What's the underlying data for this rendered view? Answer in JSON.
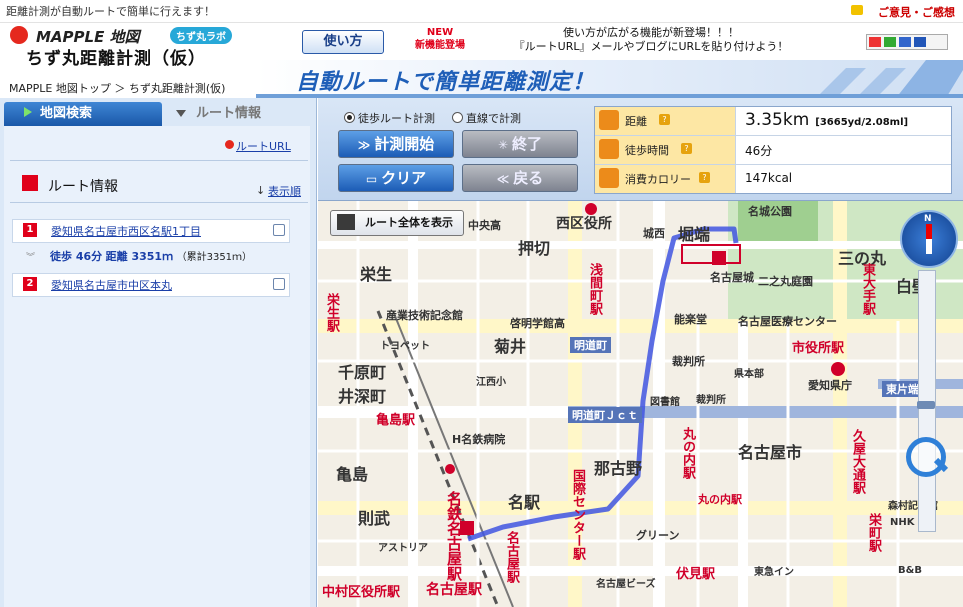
{
  "topbar": {
    "message": "距離計測が自動ルートで簡単に行えます！",
    "feedback_label": "ご意見・ご感想"
  },
  "header": {
    "brand": "MAPPLE 地図",
    "lab_badge": "ちず丸ラボ",
    "app_title": "ちず丸距離計測（仮）",
    "howto_label": "使い方",
    "new_badge_line1": "NEW",
    "new_badge_line2": "新機能登場",
    "news_line1": "使い方が広がる機能が新登場！！！",
    "news_line2": "『ルートURL』メールやブログにURLを貼り付けよう！",
    "breadcrumb_home": "MAPPLE 地図トップ",
    "breadcrumb_sep": "＞",
    "breadcrumb_current": "ちず丸距離計測(仮)",
    "banner_text": "自動ルートで簡単距離測定！"
  },
  "sidebar": {
    "tab_search": "地図検索",
    "tab_route": "ルート情報",
    "route_url_label": "ルートURL",
    "route_heading": "ルート情報",
    "order_label": "表示順",
    "waypoints": [
      {
        "num": "1",
        "address": "愛知県名古屋市西区名駅1丁目"
      },
      {
        "num": "2",
        "address": "愛知県名古屋市中区本丸"
      }
    ],
    "segment": {
      "walk_label": "徒歩 46分",
      "distance_label": "距離 3351ｍ",
      "cumulative": "（累計3351ｍ）"
    }
  },
  "controls": {
    "mode_walk": "徒歩ルート計測",
    "mode_straight": "直線で計測",
    "mode_selected": "walk",
    "start_label": "計測開始",
    "end_label": "終了",
    "clear_label": "クリア",
    "back_label": "戻る"
  },
  "stats": {
    "distance_label": "距離",
    "distance_value": "3.35km",
    "distance_sub": "[3665yd/2.08ml]",
    "walk_time_label": "徒歩時間",
    "walk_time_value": "46分",
    "calorie_label": "消費カロリー",
    "calorie_value": "147kcal",
    "help_mark": "?"
  },
  "map": {
    "full_route_label": "ルート全体を表示",
    "compass_n": "N",
    "labels": [
      {
        "t": "西区役所",
        "c": "#333",
        "s": 14
      },
      {
        "t": "中央高",
        "c": "#333",
        "s": 11
      },
      {
        "t": "押切",
        "c": "#333",
        "s": 16
      },
      {
        "t": "城西",
        "c": "#333",
        "s": 11
      },
      {
        "t": "堀端",
        "c": "#333",
        "s": 16
      },
      {
        "t": "名城公園",
        "c": "#333",
        "s": 11
      },
      {
        "t": "三の丸",
        "c": "#333",
        "s": 16
      },
      {
        "t": "栄生",
        "c": "#333",
        "s": 16
      },
      {
        "t": "名古屋城",
        "c": "#333",
        "s": 11
      },
      {
        "t": "二之丸庭園",
        "c": "#333",
        "s": 11
      },
      {
        "t": "東大手駅",
        "c": "#d0002a",
        "s": 13
      },
      {
        "t": "栄生駅",
        "c": "#d0002a",
        "s": 13
      },
      {
        "t": "産業技術記念館",
        "c": "#333",
        "s": 11
      },
      {
        "t": "啓明学館高",
        "c": "#333",
        "s": 11
      },
      {
        "t": "浅間町駅",
        "c": "#d0002a",
        "s": 13
      },
      {
        "t": "能楽堂",
        "c": "#333",
        "s": 11
      },
      {
        "t": "名古屋医療センター",
        "c": "#333",
        "s": 11
      },
      {
        "t": "白壁",
        "c": "#333",
        "s": 16
      },
      {
        "t": "トヨペット",
        "c": "#333",
        "s": 10
      },
      {
        "t": "菊井",
        "c": "#333",
        "s": 16
      },
      {
        "t": "明道町",
        "c": "#fff",
        "s": 11
      },
      {
        "t": "裁判所",
        "c": "#333",
        "s": 11
      },
      {
        "t": "市役所駅",
        "c": "#d0002a",
        "s": 13
      },
      {
        "t": "千原町",
        "c": "#333",
        "s": 16
      },
      {
        "t": "井深町",
        "c": "#333",
        "s": 16
      },
      {
        "t": "江西小",
        "c": "#333",
        "s": 10
      },
      {
        "t": "県本部",
        "c": "#333",
        "s": 10
      },
      {
        "t": "愛知県庁",
        "c": "#333",
        "s": 11
      },
      {
        "t": "東片端",
        "c": "#fff",
        "s": 11
      },
      {
        "t": "明道町Ｊｃｔ",
        "c": "#fff",
        "s": 11
      },
      {
        "t": "亀島駅",
        "c": "#d0002a",
        "s": 13
      },
      {
        "t": "図書館",
        "c": "#333",
        "s": 10
      },
      {
        "t": "裁判所",
        "c": "#333",
        "s": 10
      },
      {
        "t": "H名鉄病院",
        "c": "#333",
        "s": 11
      },
      {
        "t": "丸の内駅",
        "c": "#d0002a",
        "s": 13
      },
      {
        "t": "名古屋市",
        "c": "#333",
        "s": 16
      },
      {
        "t": "那古野",
        "c": "#333",
        "s": 16
      },
      {
        "t": "久屋大通駅",
        "c": "#d0002a",
        "s": 13
      },
      {
        "t": "亀島",
        "c": "#333",
        "s": 16
      },
      {
        "t": "国際センター駅",
        "c": "#d0002a",
        "s": 13
      },
      {
        "t": "名駅",
        "c": "#333",
        "s": 16
      },
      {
        "t": "則武",
        "c": "#333",
        "s": 16
      },
      {
        "t": "名鉄名古屋駅",
        "c": "#d0002a",
        "s": 15
      },
      {
        "t": "丸の内駅",
        "c": "#d0002a",
        "s": 11
      },
      {
        "t": "森村記念館",
        "c": "#333",
        "s": 10
      },
      {
        "t": "NHK",
        "c": "#333",
        "s": 10
      },
      {
        "t": "栄町駅",
        "c": "#d0002a",
        "s": 13
      },
      {
        "t": "グリーン",
        "c": "#333",
        "s": 11
      },
      {
        "t": "アストリア",
        "c": "#333",
        "s": 10
      },
      {
        "t": "伏見駅",
        "c": "#d0002a",
        "s": 13
      },
      {
        "t": "名古屋ビーズ",
        "c": "#333",
        "s": 10
      },
      {
        "t": "東急イン",
        "c": "#333",
        "s": 10
      },
      {
        "t": "中村区役所駅",
        "c": "#d0002a",
        "s": 13
      },
      {
        "t": "名古屋駅",
        "c": "#d0002a",
        "s": 14
      },
      {
        "t": "名古屋駅",
        "c": "#d0002a",
        "s": 13
      },
      {
        "t": "B&B",
        "c": "#333",
        "s": 10
      }
    ]
  },
  "colors": {
    "route": "#3f55e0",
    "station": "#d0002a",
    "accent": "#1f5fb8"
  }
}
